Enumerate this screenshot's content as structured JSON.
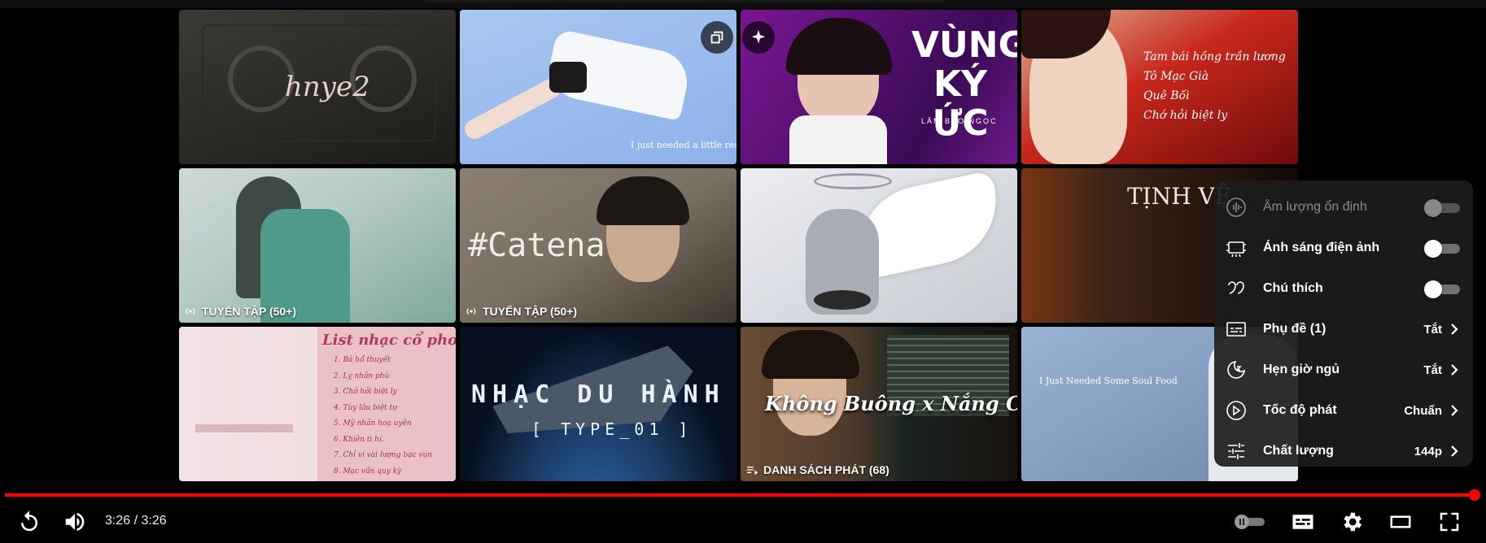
{
  "grid": {
    "tiles": [
      {
        "caption": "hnye2",
        "badge": "",
        "colors": [
          "#3a3b35",
          "#1b1c18"
        ]
      },
      {
        "caption": "I just needed a little reset.",
        "badge": "",
        "colors": [
          "#a9c6f0",
          "#8cb2ea"
        ]
      },
      {
        "caption": "VÙNG KÝ ỨC",
        "subcaption": "LÂM BẢO NGỌC",
        "badge": "",
        "colors": [
          "#a21fb9",
          "#3a0b55"
        ]
      },
      {
        "caption": "Tam bái hồng trần lương\nTô Mạc Già\nQuê Bối\nChớ hỏi biệt ly",
        "badge": "",
        "colors": [
          "#c8281c",
          "#6e0b0b"
        ]
      },
      {
        "caption": "",
        "badge": "TUYỂN TẬP (50+)",
        "colors": [
          "#cfd8d6",
          "#7fa89b"
        ]
      },
      {
        "caption": "#Catena",
        "badge": "TUYỂN TẬP (50+)",
        "colors": [
          "#7a6f63",
          "#3e352c"
        ]
      },
      {
        "caption": "",
        "badge": "",
        "colors": [
          "#eceef3",
          "#c7cad2"
        ]
      },
      {
        "caption": "TỊNH VỆ",
        "badge": "",
        "colors": [
          "#3d2417",
          "#120a06"
        ]
      },
      {
        "caption": "List nhạc cổ phong",
        "list": [
          "1. Bá hổ thuyết",
          "2. Lỵ nhân phù",
          "3. Chớ hỏi biệt ly",
          "4. Tùy lâu biệt tự",
          "5. Mỹ nhân hoạ uyên",
          "6. Khiên ti hí.",
          "7. Chỉ vì vài lượng bạc vụn",
          "8. Mạc vấn quy kỳ"
        ],
        "badge": "",
        "colors": [
          "#f3dde0",
          "#e9c1c6"
        ]
      },
      {
        "caption": "NHẠC DU HÀNH",
        "subcaption": "[ TYPE_01 ]",
        "badge": "",
        "colors": [
          "#1d3f6c",
          "#06101f"
        ]
      },
      {
        "caption": "Không Buông x Nắng Có Về",
        "badge": "DANH SÁCH PHÁT (68)",
        "colors": [
          "#4d3a2b",
          "#17110c"
        ]
      },
      {
        "caption": "I Just Needed Some Soul Food",
        "badge": "",
        "colors": [
          "#9ab3d4",
          "#6f88ad"
        ]
      }
    ]
  },
  "settings_menu": {
    "items": [
      {
        "label": "Âm lượng ổn định",
        "type": "toggle",
        "disabled": true,
        "icon": "stable-volume-icon"
      },
      {
        "label": "Ánh sáng điện ảnh",
        "type": "toggle",
        "disabled": false,
        "icon": "ambient-mode-icon"
      },
      {
        "label": "Chú thích",
        "type": "toggle",
        "disabled": false,
        "icon": "annotations-icon"
      },
      {
        "label": "Phụ đề (1)",
        "type": "submenu",
        "value": "Tắt",
        "icon": "subtitles-icon"
      },
      {
        "label": "Hẹn giờ ngủ",
        "type": "submenu",
        "value": "Tắt",
        "icon": "sleep-timer-icon"
      },
      {
        "label": "Tốc độ phát",
        "type": "submenu",
        "value": "Chuẩn",
        "icon": "playback-speed-icon"
      },
      {
        "label": "Chất lượng",
        "type": "submenu",
        "value": "144p",
        "icon": "quality-icon"
      }
    ]
  },
  "player": {
    "time": "3:26 / 3:26",
    "progress": 1.0,
    "accent": "#ff0000"
  }
}
